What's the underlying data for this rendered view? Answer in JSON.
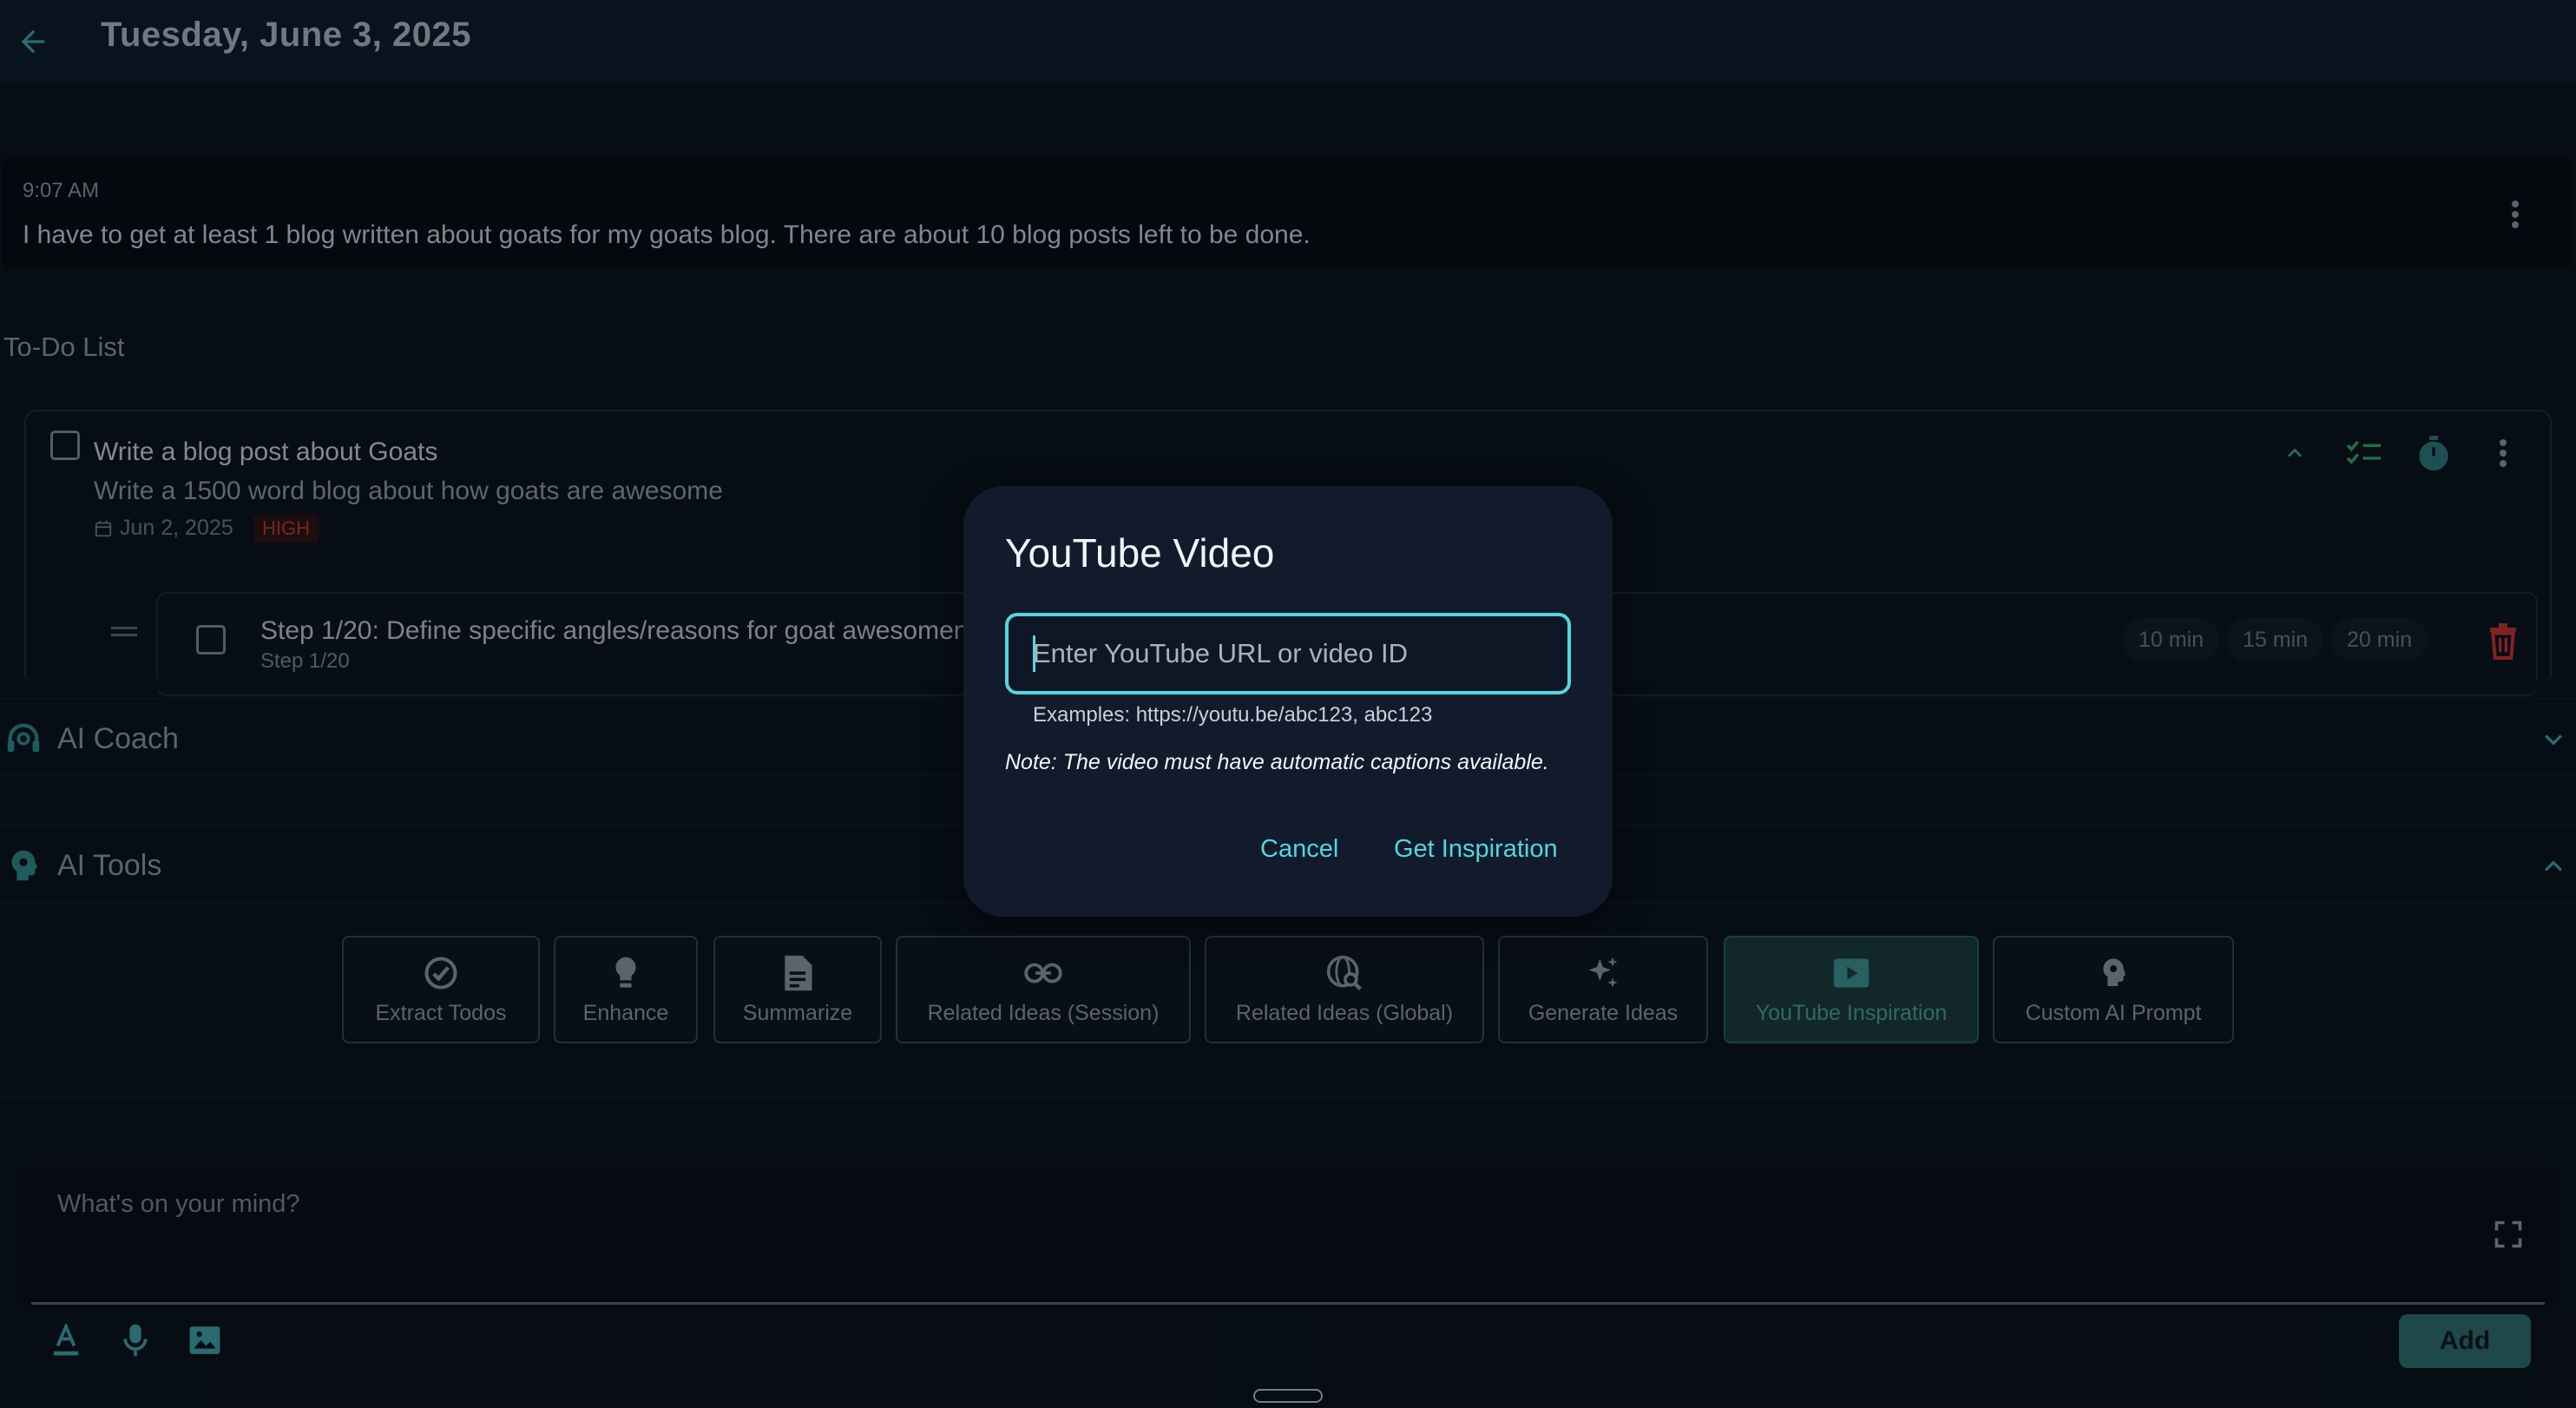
{
  "header": {
    "title": "Tuesday, June 3, 2025"
  },
  "entry": {
    "time": "9:07 AM",
    "text": "I have to get at least 1 blog written about goats for my goats blog. There are about 10 blog posts left to be done."
  },
  "todo_section": {
    "heading": "To-Do List"
  },
  "todo": {
    "title": "Write a blog post about Goats",
    "description": "Write a 1500 word blog about how goats are awesome",
    "date": "Jun 2, 2025",
    "priority": "HIGH"
  },
  "step": {
    "title": "Step 1/20: Define specific angles/reasons for goat awesomeness",
    "subtitle": "Step 1/20",
    "time_options": [
      "10 min",
      "15 min",
      "20 min"
    ]
  },
  "sections": {
    "ai_coach": "AI Coach",
    "ai_tools": "AI Tools"
  },
  "tools": [
    {
      "label": "Extract Todos",
      "icon": "check-circle-icon"
    },
    {
      "label": "Enhance",
      "icon": "lightbulb-icon"
    },
    {
      "label": "Summarize",
      "icon": "document-icon"
    },
    {
      "label": "Related Ideas (Session)",
      "icon": "link-icon"
    },
    {
      "label": "Related Ideas (Global)",
      "icon": "globe-search-icon"
    },
    {
      "label": "Generate Ideas",
      "icon": "sparkle-icon"
    },
    {
      "label": "YouTube Inspiration",
      "icon": "youtube-icon",
      "active": true
    },
    {
      "label": "Custom AI Prompt",
      "icon": "head-gear-icon"
    }
  ],
  "composer": {
    "placeholder": "What's on your mind?",
    "add_label": "Add"
  },
  "modal": {
    "title": "YouTube Video",
    "input_placeholder": "Enter YouTube URL or video ID",
    "input_value": "",
    "helper": "Examples: https://youtu.be/abc123, abc123",
    "note": "Note: The video must have automatic captions available.",
    "cancel_label": "Cancel",
    "confirm_label": "Get Inspiration"
  },
  "colors": {
    "accent": "#53d6de",
    "teal_button": "#2e6e70",
    "priority_high": "#b73838",
    "background": "#0c1420"
  }
}
